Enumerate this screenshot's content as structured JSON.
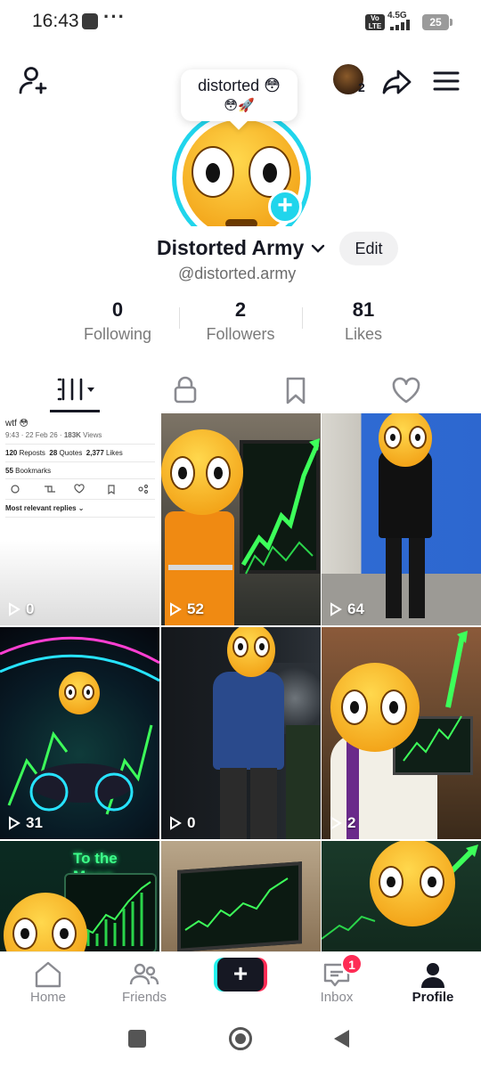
{
  "status_bar": {
    "time": "16:43",
    "more": "···",
    "volte": "Vo LTE",
    "network": "4.5G",
    "battery": "25"
  },
  "header": {
    "add_friend_icon": "person-plus-icon",
    "story_bubble_line1": "distorted 😳",
    "story_bubble_line2": "😳🚀",
    "accounts_count": "2",
    "share_icon": "share-arrow-icon",
    "menu_icon": "hamburger-icon"
  },
  "profile": {
    "display_name": "Distorted Army",
    "username": "@distorted.army",
    "edit_label": "Edit",
    "accent": "#20d5ec"
  },
  "stats": [
    {
      "value": "0",
      "label": "Following"
    },
    {
      "value": "2",
      "label": "Followers"
    },
    {
      "value": "81",
      "label": "Likes"
    }
  ],
  "tabs": [
    "videos-grid-icon",
    "lock-icon",
    "bookmark-icon",
    "heart-icon"
  ],
  "tweet": {
    "text": "wtf 😳",
    "meta_prefix": "9:43 · 22 Feb 26 · ",
    "views_count": "183K",
    "views_label": " Views",
    "reposts_count": "120",
    "reposts_label": " Reposts",
    "quotes_count": "28",
    "quotes_label": " Quotes",
    "likes_count": "2,377",
    "likes_label": " Likes",
    "bookmarks_count": "55",
    "bookmarks_label": " Bookmarks",
    "replies_label": "Most relevant replies ⌄"
  },
  "videos": [
    {
      "views": "0"
    },
    {
      "views": "52"
    },
    {
      "views": "64"
    },
    {
      "views": "31"
    },
    {
      "views": "0"
    },
    {
      "views": "2"
    },
    {
      "caption": "To the Moon"
    },
    {},
    {}
  ],
  "bottom_nav": {
    "items": [
      {
        "label": "Home"
      },
      {
        "label": "Friends"
      },
      {
        "label": "Inbox"
      },
      {
        "label": "Profile"
      }
    ],
    "inbox_badge": "1"
  }
}
